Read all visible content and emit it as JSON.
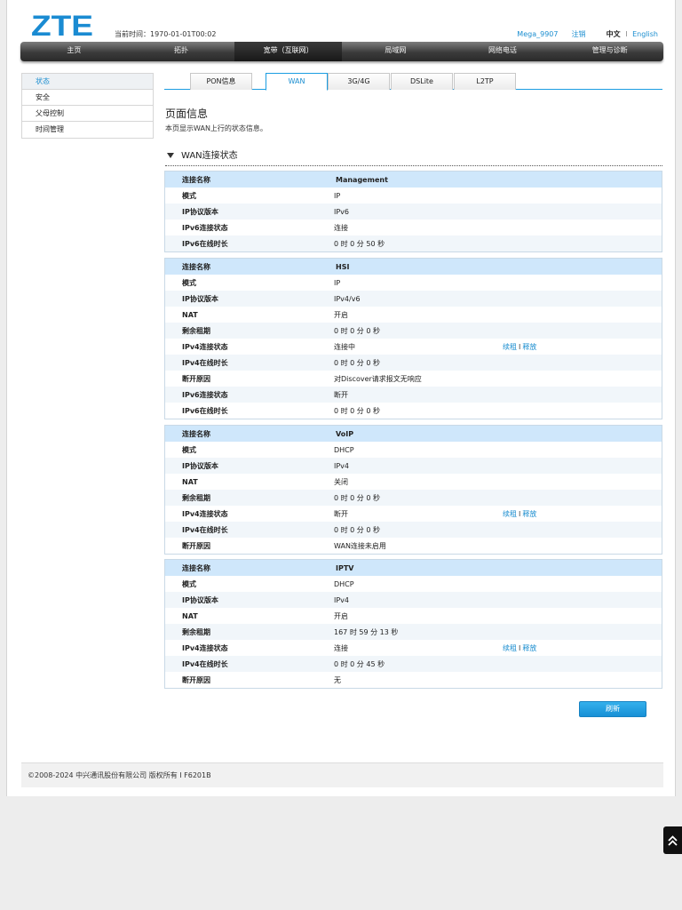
{
  "header": {
    "logo_text": "ZTE",
    "time_label": "当前时间：1970-01-01T00:02",
    "user": "Mega_9907",
    "logout": "注销",
    "lang_current": "中文",
    "lang_sep": "I",
    "lang_other": "English"
  },
  "nav": [
    "主页",
    "拓扑",
    "宽带（互联网）",
    "局域网",
    "网络电话",
    "管理与诊断"
  ],
  "sidebar": [
    "状态",
    "安全",
    "父母控制",
    "时间管理"
  ],
  "tabs": [
    "PON信息",
    "WAN",
    "3G/4G",
    "DSLite",
    "L2TP"
  ],
  "page": {
    "title": "页面信息",
    "desc": "本页显示WAN上行的状态信息。",
    "section": "WAN连接状态"
  },
  "wan": [
    {
      "rows": [
        {
          "label": "连接名称",
          "value": "Management"
        },
        {
          "label": "模式",
          "value": "IP"
        },
        {
          "label": "IP协议版本",
          "value": "IPv6"
        },
        {
          "label": "IPv6连接状态",
          "value": "连接"
        },
        {
          "label": "IPv6在线时长",
          "value": "0 时 0 分 50 秒"
        }
      ]
    },
    {
      "rows": [
        {
          "label": "连接名称",
          "value": "HSI"
        },
        {
          "label": "模式",
          "value": "IP"
        },
        {
          "label": "IP协议版本",
          "value": "IPv4/v6"
        },
        {
          "label": "NAT",
          "value": "开启"
        },
        {
          "label": "剩余租期",
          "value": "0 时 0 分 0 秒"
        },
        {
          "label": "IPv4连接状态",
          "value": "连接中",
          "renew": "续租",
          "release": "释放"
        },
        {
          "label": "IPv4在线时长",
          "value": "0 时 0 分 0 秒"
        },
        {
          "label": "断开原因",
          "value": "对Discover请求报文无响应"
        },
        {
          "label": "IPv6连接状态",
          "value": "断开"
        },
        {
          "label": "IPv6在线时长",
          "value": "0 时 0 分 0 秒"
        }
      ]
    },
    {
      "rows": [
        {
          "label": "连接名称",
          "value": "VoIP"
        },
        {
          "label": "模式",
          "value": "DHCP"
        },
        {
          "label": "IP协议版本",
          "value": "IPv4"
        },
        {
          "label": "NAT",
          "value": "关闭"
        },
        {
          "label": "剩余租期",
          "value": "0 时 0 分 0 秒"
        },
        {
          "label": "IPv4连接状态",
          "value": "断开",
          "renew": "续租",
          "release": "释放"
        },
        {
          "label": "IPv4在线时长",
          "value": "0 时 0 分 0 秒"
        },
        {
          "label": "断开原因",
          "value": "WAN连接未启用"
        }
      ]
    },
    {
      "rows": [
        {
          "label": "连接名称",
          "value": "IPTV"
        },
        {
          "label": "模式",
          "value": "DHCP"
        },
        {
          "label": "IP协议版本",
          "value": "IPv4"
        },
        {
          "label": "NAT",
          "value": "开启"
        },
        {
          "label": "剩余租期",
          "value": "167 时 59 分 13 秒"
        },
        {
          "label": "IPv4连接状态",
          "value": "连接",
          "renew": "续租",
          "release": "释放"
        },
        {
          "label": "IPv4在线时长",
          "value": "0 时 0 分 45 秒"
        },
        {
          "label": "断开原因",
          "value": "无"
        }
      ]
    }
  ],
  "refresh_label": "刷新",
  "footer": "©2008-2024 中兴通讯股份有限公司 版权所有  I   F6201B"
}
